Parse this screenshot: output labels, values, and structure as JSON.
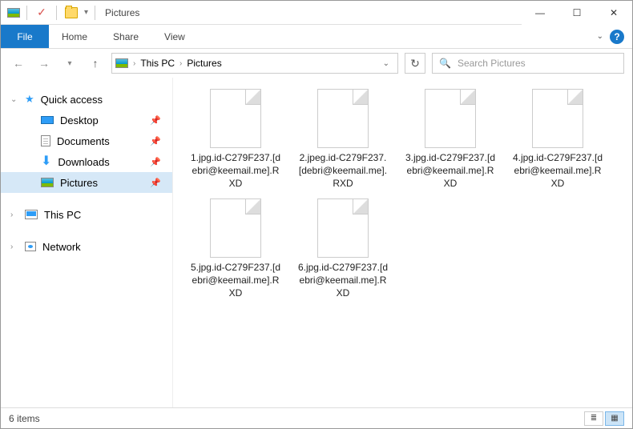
{
  "titlebar": {
    "title": "Pictures"
  },
  "ribbon": {
    "file": "File",
    "tabs": [
      "Home",
      "Share",
      "View"
    ]
  },
  "breadcrumb": {
    "root": "This PC",
    "current": "Pictures"
  },
  "search": {
    "placeholder": "Search Pictures"
  },
  "sidebar": {
    "quick_access": "Quick access",
    "items": [
      {
        "label": "Desktop",
        "pinned": true
      },
      {
        "label": "Documents",
        "pinned": true
      },
      {
        "label": "Downloads",
        "pinned": true
      },
      {
        "label": "Pictures",
        "pinned": true,
        "selected": true
      }
    ],
    "this_pc": "This PC",
    "network": "Network"
  },
  "files": [
    "1.jpg.id-C279F237.[debri@keemail.me].RXD",
    "2.jpeg.id-C279F237.[debri@keemail.me].RXD",
    "3.jpg.id-C279F237.[debri@keemail.me].RXD",
    "4.jpg.id-C279F237.[debri@keemail.me].RXD",
    "5.jpg.id-C279F237.[debri@keemail.me].RXD",
    "6.jpg.id-C279F237.[debri@keemail.me].RXD"
  ],
  "status": {
    "count_label": "6 items"
  }
}
